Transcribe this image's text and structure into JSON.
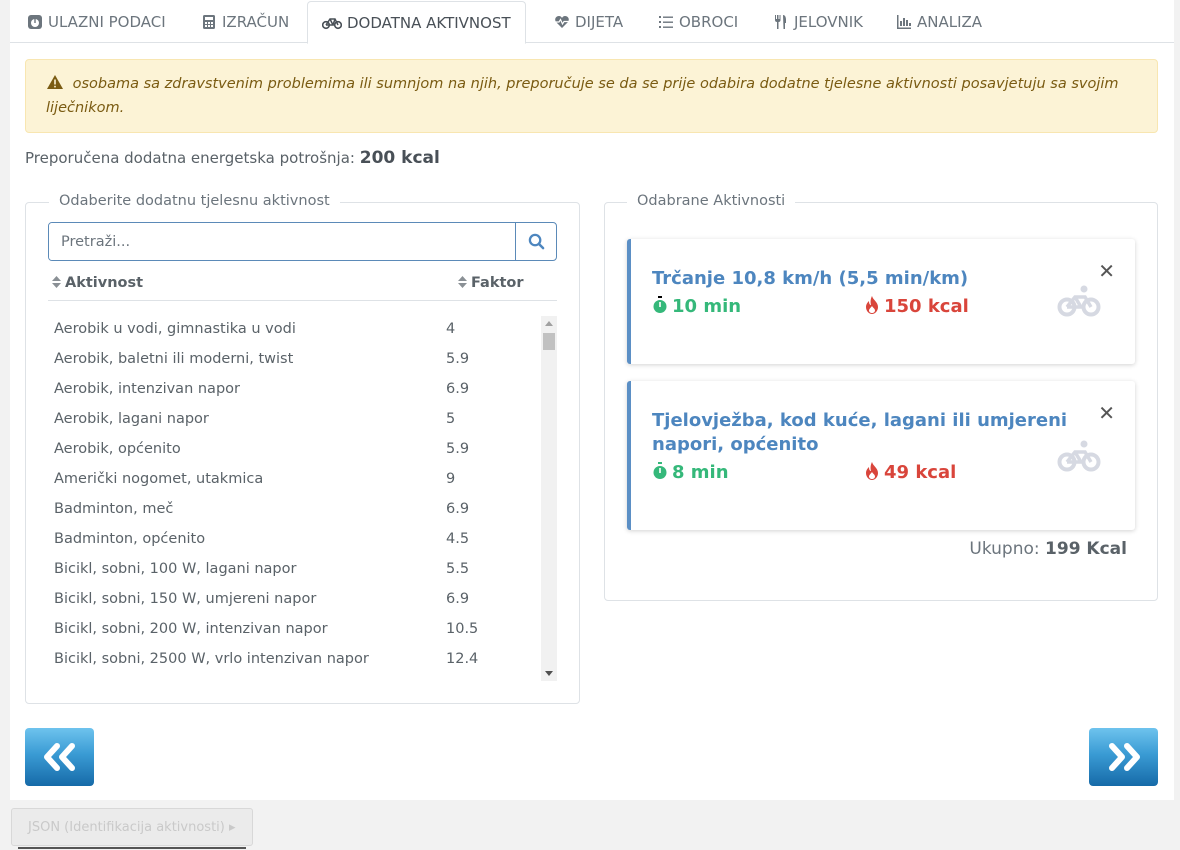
{
  "tabs": [
    {
      "label": "ULAZNI PODACI",
      "icon": "tachometer-icon"
    },
    {
      "label": "IZRAČUN",
      "icon": "calculator-icon"
    },
    {
      "label": "DODATNA AKTIVNOST",
      "icon": "bicycle-icon",
      "active": true
    },
    {
      "label": "DIJETA",
      "icon": "heartbeat-icon"
    },
    {
      "label": "OBROCI",
      "icon": "list-icon"
    },
    {
      "label": "JELOVNIK",
      "icon": "utensils-icon"
    },
    {
      "label": "ANALIZA",
      "icon": "chart-bar-icon"
    }
  ],
  "alert": {
    "text": "osobama sa zdravstvenim problemima ili sumnjom na njih, preporučuje se da se prije odabira dodatne tjelesne aktivnosti posavjetuju sa svojim liječnikom."
  },
  "recommendation": {
    "label": "Preporučena dodatna energetska potrošnja:",
    "value": "200 kcal"
  },
  "activity_picker": {
    "legend": "Odaberite dodatnu tjelesnu aktivnost",
    "search_placeholder": "Pretraži...",
    "columns": [
      "Aktivnost",
      "Faktor"
    ],
    "rows": [
      {
        "name": "Aerobik u vodi, gimnastika u vodi",
        "factor": "4"
      },
      {
        "name": "Aerobik, baletni ili moderni, twist",
        "factor": "5.9"
      },
      {
        "name": "Aerobik, intenzivan napor",
        "factor": "6.9"
      },
      {
        "name": "Aerobik, lagani napor",
        "factor": "5"
      },
      {
        "name": "Aerobik, općenito",
        "factor": "5.9"
      },
      {
        "name": "Američki nogomet, utakmica",
        "factor": "9"
      },
      {
        "name": "Badminton, meč",
        "factor": "6.9"
      },
      {
        "name": "Badminton, općenito",
        "factor": "4.5"
      },
      {
        "name": "Bicikl, sobni, 100 W, lagani napor",
        "factor": "5.5"
      },
      {
        "name": "Bicikl, sobni, 150 W, umjereni napor",
        "factor": "6.9"
      },
      {
        "name": "Bicikl, sobni, 200 W, intenzivan napor",
        "factor": "10.5"
      },
      {
        "name": "Bicikl, sobni, 2500 W, vrlo intenzivan napor",
        "factor": "12.4"
      }
    ]
  },
  "selected": {
    "legend": "Odabrane Aktivnosti",
    "items": [
      {
        "title": "Trčanje 10,8 km/h (5,5 min/km)",
        "duration": "10 min",
        "kcal": "150 kcal"
      },
      {
        "title": "Tjelovježba, kod kuće, lagani ili umjereni napori, općenito",
        "duration": "8 min",
        "kcal": "49 kcal"
      }
    ],
    "total_label": "Ukupno:",
    "total_value": "199 Kcal"
  },
  "bottom_button": "JSON (Identifikacija aktivnosti) ▸",
  "colors": {
    "card_title": "#4d86bf",
    "time_green": "#35b87a",
    "kcal_red": "#d9453b",
    "alert_bg": "#fcf3d6"
  }
}
